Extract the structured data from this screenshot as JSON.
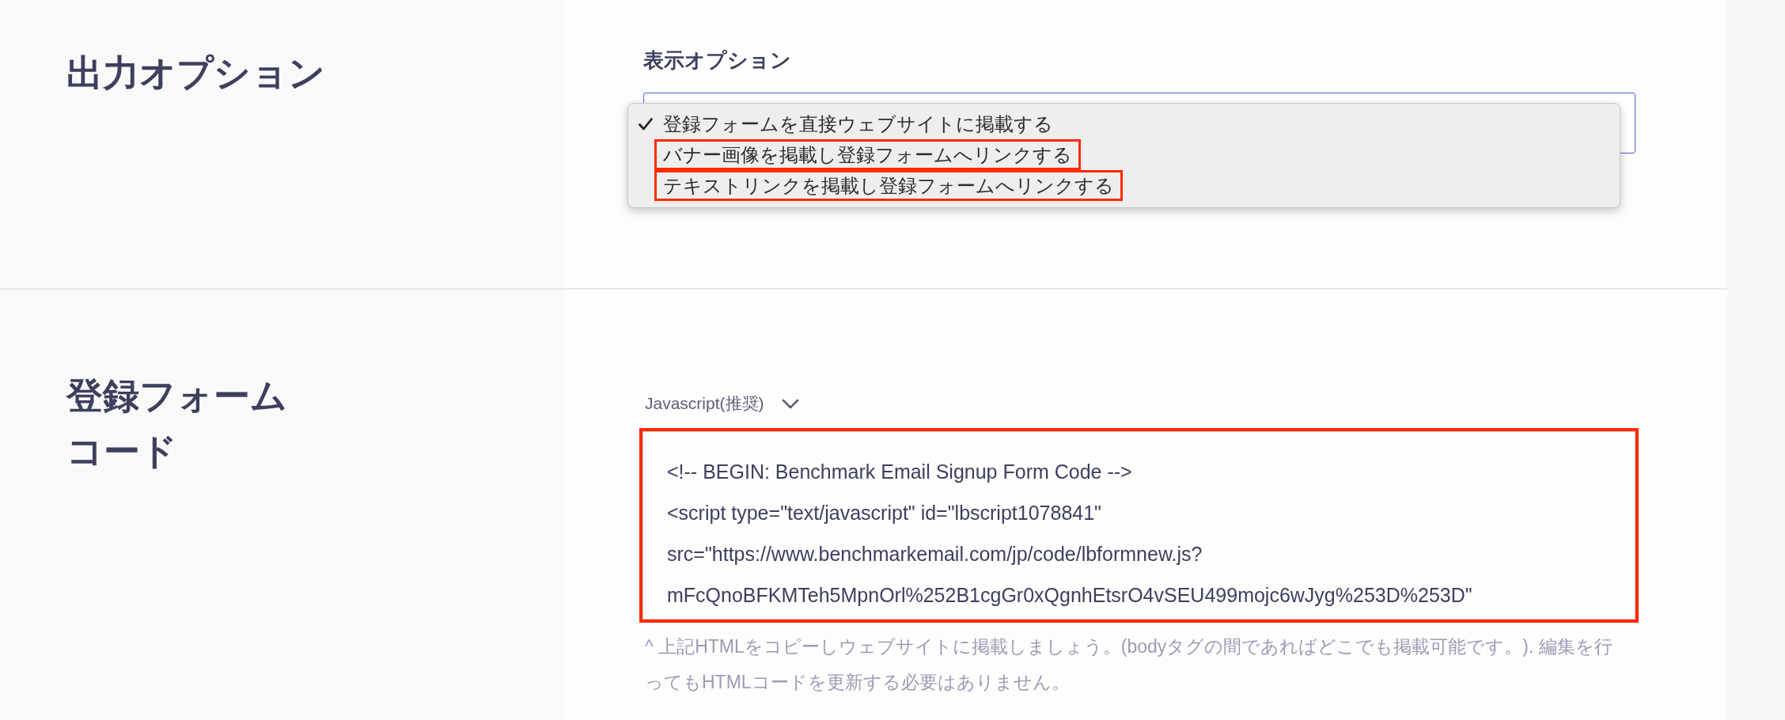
{
  "output_options": {
    "heading": "出力オプション",
    "display_option": {
      "label": "表示オプション",
      "menu": [
        {
          "label": "登録フォームを直接ウェブサイトに掲載する",
          "selected": true,
          "highlighted": false
        },
        {
          "label": "バナー画像を掲載し登録フォームへリンクする",
          "selected": false,
          "highlighted": true
        },
        {
          "label": "テキストリンクを掲載し登録フォームへリンクする",
          "selected": false,
          "highlighted": true
        }
      ]
    }
  },
  "form_code": {
    "heading": "登録フォームコード",
    "format_dropdown": {
      "value": "Javascript(推奨)"
    },
    "code_box": {
      "highlighted": true,
      "lines": [
        "<!-- BEGIN: Benchmark Email Signup Form Code -->",
        "<script type=\"text/javascript\" id=\"lbscript1078841\"",
        "src=\"https://www.benchmarkemail.com/jp/code/lbformnew.js?",
        "mFcQnoBFKMTeh5MpnOrl%252B1cgGr0xQgnhEtsrO4vSEU499mojc6wJyg%253D%253D\""
      ]
    },
    "note": "^ 上記HTMLをコピーしウェブサイトに掲載しましょう。(bodyタグの間であればどこでも掲載可能です。). 編集を行ってもHTMLコードを更新する必要はありません。"
  }
}
